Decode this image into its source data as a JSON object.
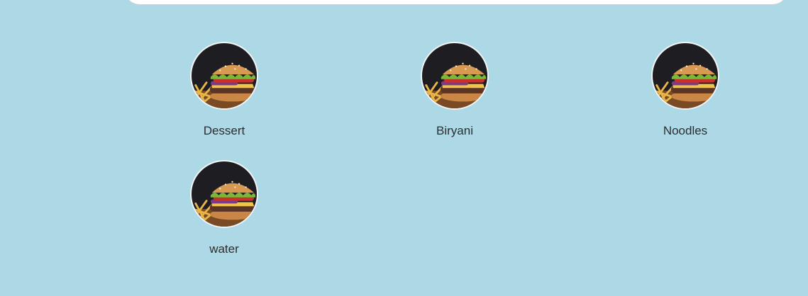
{
  "categories": [
    {
      "label": "Dessert",
      "icon": "burger-image"
    },
    {
      "label": "Biryani",
      "icon": "burger-image"
    },
    {
      "label": "Noodles",
      "icon": "burger-image"
    },
    {
      "label": "water",
      "icon": "burger-image"
    }
  ],
  "colors": {
    "background": "#add8e6",
    "image_dark": "#1d1d22",
    "bun": "#d89a52",
    "patty": "#5a3526",
    "lettuce": "#7ab838",
    "tomato": "#c9302c",
    "fries": "#e8b547"
  }
}
